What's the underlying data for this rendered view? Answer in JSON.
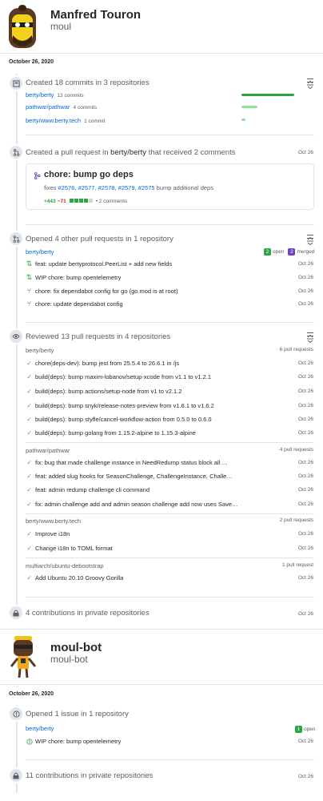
{
  "users": [
    {
      "name": "Manfred Touron",
      "login": "moul",
      "date": "October 26, 2020"
    },
    {
      "name": "moul-bot",
      "login": "moul-bot",
      "date": "October 26, 2020"
    }
  ],
  "commits": {
    "header": "Created 18 commits in 3 repositories",
    "repos": [
      {
        "name": "berty/berty",
        "count": "13 commits",
        "pct": 1.0
      },
      {
        "name": "pathwar/pathwar",
        "count": "4 commits",
        "pct": 0.3
      },
      {
        "name": "berty/www.berty.tech",
        "count": "1 commit",
        "pct": 0.08
      }
    ]
  },
  "pr_created": {
    "prefix": "Created a pull request in",
    "repo": "berty/berty",
    "suffix": "that received 2 comments",
    "date": "Oct 26",
    "title": "chore: bump go deps",
    "fixes_label": "fixes",
    "fixes": [
      "#2576,",
      "#2577,",
      "#2578,",
      "#2579,",
      "#2575"
    ],
    "desc": "bump additional deps",
    "additions": "+443",
    "deletions": "−71",
    "comments": "• 2 comments"
  },
  "opened_prs": {
    "header": "Opened 4 other pull requests in 1 repository",
    "repo": "berty/berty",
    "open_n": "2",
    "open_label": "open",
    "merged_n": "2",
    "merged_label": "merged",
    "items": [
      {
        "title": "feat: update bertyprotocol.PeerList + add new fields",
        "date": "Oct 26",
        "state": "open"
      },
      {
        "title": "WIP chore: bump opentelemetry",
        "date": "Oct 26",
        "state": "open"
      },
      {
        "title": "chore: fix dependabot config for go (go.mod is at root)",
        "date": "Oct 26",
        "state": "merged"
      },
      {
        "title": "chore: update dependabot config",
        "date": "Oct 26",
        "state": "merged"
      }
    ]
  },
  "reviewed": {
    "header": "Reviewed 13 pull requests in 4 repositories",
    "groups": [
      {
        "repo": "berty/berty",
        "count": "6 pull requests",
        "items": [
          {
            "title": "chore(deps-dev): bump jest from 25.5.4 to 26.6.1 in /js",
            "date": "Oct 26"
          },
          {
            "title": "build(deps): bump maxim-lobanov/setup-xcode from v1.1 to v1.2.1",
            "date": "Oct 26"
          },
          {
            "title": "build(deps): bump actions/setup-node from v1 to v2.1.2",
            "date": "Oct 26"
          },
          {
            "title": "build(deps): bump snyk/release-notes-preview from v1.6.1 to v1.6.2",
            "date": "Oct 26"
          },
          {
            "title": "build(deps): bump styfle/cancel-workflow-action from 0.5.0 to 0.6.0",
            "date": "Oct 26"
          },
          {
            "title": "build(deps): bump golang from 1.15.2-alpine to 1.15.3-alpine",
            "date": "Oct 26"
          }
        ]
      },
      {
        "repo": "pathwar/pathwar",
        "count": "4 pull requests",
        "items": [
          {
            "title": "fix: bug that made challenge instance in NeedRedump status block all …",
            "date": "Oct 26"
          },
          {
            "title": "feat: added slug hooks for SeasonChallenge, ChallengeInstance, Challe…",
            "date": "Oct 26"
          },
          {
            "title": "feat: admin redump challenge cli command",
            "date": "Oct 26"
          },
          {
            "title": "fix: admin challenge add and admin season challenge add now uses Save…",
            "date": "Oct 26"
          }
        ]
      },
      {
        "repo": "berty/www.berty.tech",
        "count": "2 pull requests",
        "items": [
          {
            "title": "Improve i18n",
            "date": "Oct 26"
          },
          {
            "title": "Change i18n to TOML format",
            "date": "Oct 26"
          }
        ]
      },
      {
        "repo": "multiarch/ubuntu-debootstrap",
        "count": "1 pull request",
        "items": [
          {
            "title": "Add Ubuntu 20.10 Groovy Gorilla",
            "date": "Oct 26"
          }
        ]
      }
    ]
  },
  "private1": {
    "text": "4 contributions in private repositories",
    "date": "Oct 26"
  },
  "issues": {
    "header": "Opened 1 issue in 1 repository",
    "repo": "berty/berty",
    "open_n": "1",
    "open_label": "open",
    "items": [
      {
        "title": "WIP chore: bump opentelemetry",
        "date": "Oct 26"
      }
    ]
  },
  "private2": {
    "text": "11 contributions in private repositories",
    "date": "Oct 26"
  },
  "colors": {
    "green": "#28a745",
    "purple": "#6f42c1",
    "link": "#0366d6",
    "muted": "#586069"
  }
}
